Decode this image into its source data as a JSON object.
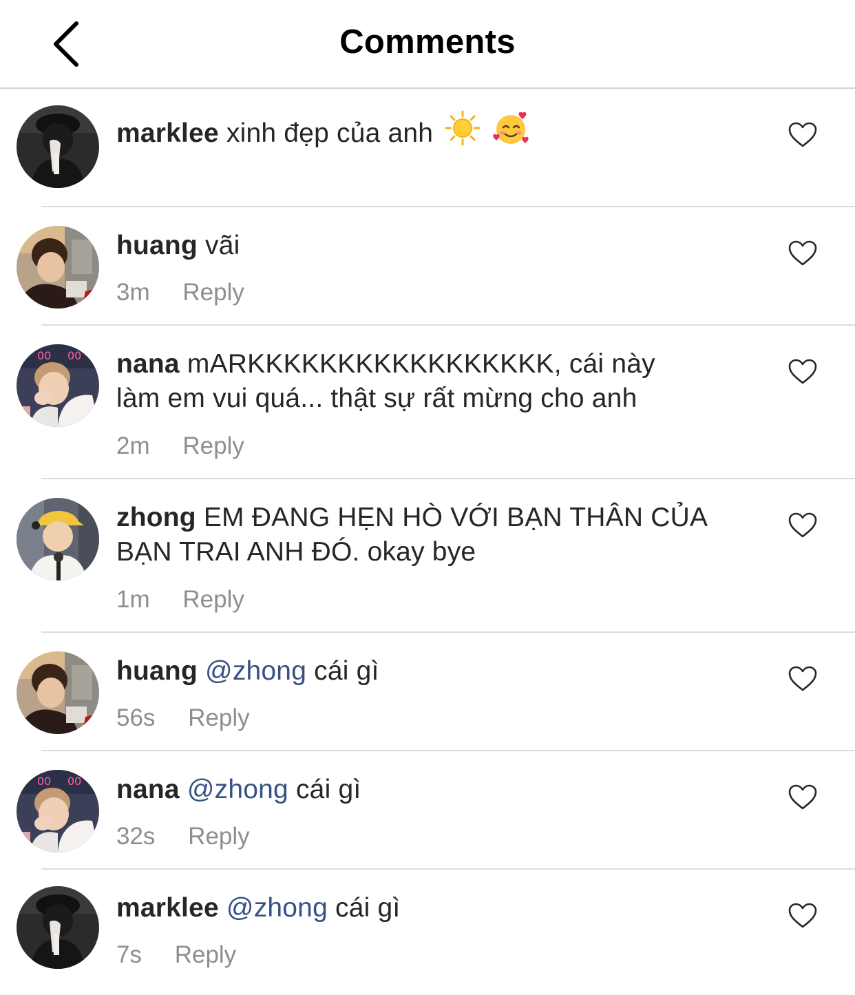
{
  "header": {
    "title": "Comments",
    "back_icon": "chevron-left-icon"
  },
  "reply_label": "Reply",
  "colors": {
    "mention": "#385185",
    "meta": "#8e8e8e",
    "separator": "#dcdcdc"
  },
  "comments": [
    {
      "username": "marklee",
      "text": "xinh đẹp của anh",
      "emojis": [
        "sun-emoji",
        "smiling-face-with-hearts-emoji"
      ],
      "time": "",
      "reply": ""
    },
    {
      "username": "huang",
      "text": "vãi",
      "time": "3m",
      "reply": "Reply"
    },
    {
      "username": "nana",
      "line1": "mARKKKKKKKKKKKKKKKKK, cái này",
      "line2": "làm em vui quá... thật sự rất mừng cho anh",
      "time": "2m",
      "reply": "Reply"
    },
    {
      "username": "zhong",
      "line1": "EM ĐANG HẸN HÒ VỚI BẠN THÂN CỦA",
      "line2": "BẠN TRAI ANH ĐÓ. okay bye",
      "time": "1m",
      "reply": "Reply"
    },
    {
      "username": "huang",
      "mention": "@zhong",
      "text": "cái gì",
      "time": "56s",
      "reply": "Reply"
    },
    {
      "username": "nana",
      "mention": "@zhong",
      "text": "cái gì",
      "time": "32s",
      "reply": "Reply"
    },
    {
      "username": "marklee",
      "mention": "@zhong",
      "text": "cái gì",
      "time": "7s",
      "reply": "Reply"
    }
  ]
}
